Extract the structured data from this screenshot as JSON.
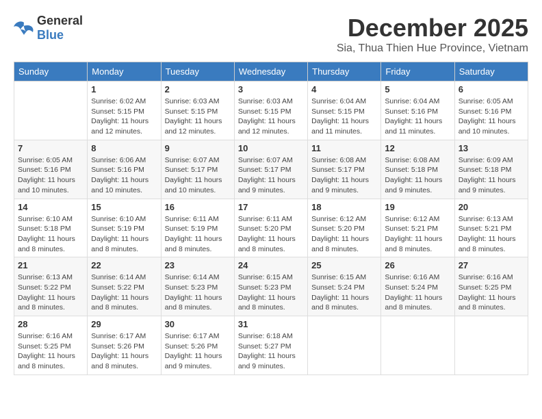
{
  "logo": {
    "general": "General",
    "blue": "Blue"
  },
  "title": "December 2025",
  "location": "Sia, Thua Thien Hue Province, Vietnam",
  "days_of_week": [
    "Sunday",
    "Monday",
    "Tuesday",
    "Wednesday",
    "Thursday",
    "Friday",
    "Saturday"
  ],
  "weeks": [
    [
      {
        "day": "",
        "info": ""
      },
      {
        "day": "1",
        "info": "Sunrise: 6:02 AM\nSunset: 5:15 PM\nDaylight: 11 hours\nand 12 minutes."
      },
      {
        "day": "2",
        "info": "Sunrise: 6:03 AM\nSunset: 5:15 PM\nDaylight: 11 hours\nand 12 minutes."
      },
      {
        "day": "3",
        "info": "Sunrise: 6:03 AM\nSunset: 5:15 PM\nDaylight: 11 hours\nand 12 minutes."
      },
      {
        "day": "4",
        "info": "Sunrise: 6:04 AM\nSunset: 5:15 PM\nDaylight: 11 hours\nand 11 minutes."
      },
      {
        "day": "5",
        "info": "Sunrise: 6:04 AM\nSunset: 5:16 PM\nDaylight: 11 hours\nand 11 minutes."
      },
      {
        "day": "6",
        "info": "Sunrise: 6:05 AM\nSunset: 5:16 PM\nDaylight: 11 hours\nand 10 minutes."
      }
    ],
    [
      {
        "day": "7",
        "info": "Sunrise: 6:05 AM\nSunset: 5:16 PM\nDaylight: 11 hours\nand 10 minutes."
      },
      {
        "day": "8",
        "info": "Sunrise: 6:06 AM\nSunset: 5:16 PM\nDaylight: 11 hours\nand 10 minutes."
      },
      {
        "day": "9",
        "info": "Sunrise: 6:07 AM\nSunset: 5:17 PM\nDaylight: 11 hours\nand 10 minutes."
      },
      {
        "day": "10",
        "info": "Sunrise: 6:07 AM\nSunset: 5:17 PM\nDaylight: 11 hours\nand 9 minutes."
      },
      {
        "day": "11",
        "info": "Sunrise: 6:08 AM\nSunset: 5:17 PM\nDaylight: 11 hours\nand 9 minutes."
      },
      {
        "day": "12",
        "info": "Sunrise: 6:08 AM\nSunset: 5:18 PM\nDaylight: 11 hours\nand 9 minutes."
      },
      {
        "day": "13",
        "info": "Sunrise: 6:09 AM\nSunset: 5:18 PM\nDaylight: 11 hours\nand 9 minutes."
      }
    ],
    [
      {
        "day": "14",
        "info": "Sunrise: 6:10 AM\nSunset: 5:18 PM\nDaylight: 11 hours\nand 8 minutes."
      },
      {
        "day": "15",
        "info": "Sunrise: 6:10 AM\nSunset: 5:19 PM\nDaylight: 11 hours\nand 8 minutes."
      },
      {
        "day": "16",
        "info": "Sunrise: 6:11 AM\nSunset: 5:19 PM\nDaylight: 11 hours\nand 8 minutes."
      },
      {
        "day": "17",
        "info": "Sunrise: 6:11 AM\nSunset: 5:20 PM\nDaylight: 11 hours\nand 8 minutes."
      },
      {
        "day": "18",
        "info": "Sunrise: 6:12 AM\nSunset: 5:20 PM\nDaylight: 11 hours\nand 8 minutes."
      },
      {
        "day": "19",
        "info": "Sunrise: 6:12 AM\nSunset: 5:21 PM\nDaylight: 11 hours\nand 8 minutes."
      },
      {
        "day": "20",
        "info": "Sunrise: 6:13 AM\nSunset: 5:21 PM\nDaylight: 11 hours\nand 8 minutes."
      }
    ],
    [
      {
        "day": "21",
        "info": "Sunrise: 6:13 AM\nSunset: 5:22 PM\nDaylight: 11 hours\nand 8 minutes."
      },
      {
        "day": "22",
        "info": "Sunrise: 6:14 AM\nSunset: 5:22 PM\nDaylight: 11 hours\nand 8 minutes."
      },
      {
        "day": "23",
        "info": "Sunrise: 6:14 AM\nSunset: 5:23 PM\nDaylight: 11 hours\nand 8 minutes."
      },
      {
        "day": "24",
        "info": "Sunrise: 6:15 AM\nSunset: 5:23 PM\nDaylight: 11 hours\nand 8 minutes."
      },
      {
        "day": "25",
        "info": "Sunrise: 6:15 AM\nSunset: 5:24 PM\nDaylight: 11 hours\nand 8 minutes."
      },
      {
        "day": "26",
        "info": "Sunrise: 6:16 AM\nSunset: 5:24 PM\nDaylight: 11 hours\nand 8 minutes."
      },
      {
        "day": "27",
        "info": "Sunrise: 6:16 AM\nSunset: 5:25 PM\nDaylight: 11 hours\nand 8 minutes."
      }
    ],
    [
      {
        "day": "28",
        "info": "Sunrise: 6:16 AM\nSunset: 5:25 PM\nDaylight: 11 hours\nand 8 minutes."
      },
      {
        "day": "29",
        "info": "Sunrise: 6:17 AM\nSunset: 5:26 PM\nDaylight: 11 hours\nand 8 minutes."
      },
      {
        "day": "30",
        "info": "Sunrise: 6:17 AM\nSunset: 5:26 PM\nDaylight: 11 hours\nand 9 minutes."
      },
      {
        "day": "31",
        "info": "Sunrise: 6:18 AM\nSunset: 5:27 PM\nDaylight: 11 hours\nand 9 minutes."
      },
      {
        "day": "",
        "info": ""
      },
      {
        "day": "",
        "info": ""
      },
      {
        "day": "",
        "info": ""
      }
    ]
  ]
}
